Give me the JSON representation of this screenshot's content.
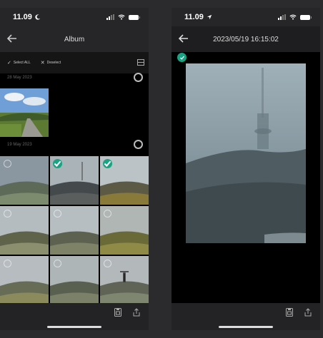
{
  "left": {
    "status": {
      "time": "11.09"
    },
    "nav": {
      "title": "Album"
    },
    "toolbar": {
      "select_all_label": "Select ALL",
      "deselect_label": "Deselect"
    },
    "sections": [
      {
        "date": "28 May 2023"
      },
      {
        "date": "19 May 2023"
      }
    ],
    "grid_selected": [
      false,
      true,
      true,
      false,
      false,
      false,
      false,
      false,
      false
    ]
  },
  "right": {
    "status": {
      "time": "11.09"
    },
    "nav": {
      "title": "2023/05/19 16:15:02"
    },
    "photo_selected": true
  },
  "colors": {
    "accent": "#19a383",
    "bar": "#262628",
    "background": "#000000"
  },
  "icons": [
    "back-arrow-icon",
    "moon-icon",
    "location-arrow-icon",
    "signal-icon",
    "wifi-icon",
    "battery-icon",
    "check-icon",
    "x-icon",
    "grid-view-icon",
    "save-icon",
    "share-icon"
  ]
}
